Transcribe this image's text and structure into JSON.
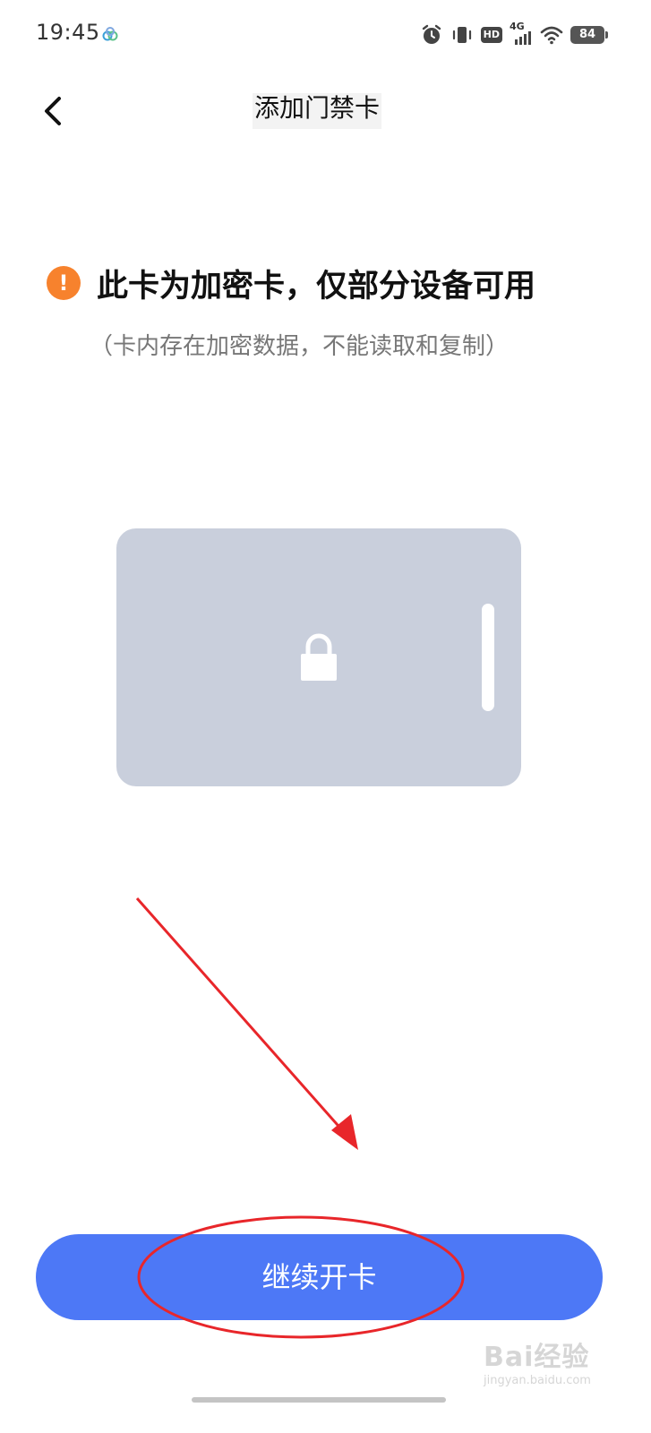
{
  "status_bar": {
    "time": "19:45",
    "network": "4G",
    "hd": "HD",
    "battery": "84"
  },
  "header": {
    "title": "添加门禁卡",
    "back_icon": "chevron-left-icon"
  },
  "warning": {
    "icon": "exclamation-circle-icon",
    "icon_glyph": "!",
    "icon_color": "#f7822d",
    "title": "此卡为加密卡，仅部分设备可用",
    "subtitle": "（卡内存在加密数据，不能读取和复制）"
  },
  "card": {
    "icon": "lock-icon",
    "color": "#c9cfdc"
  },
  "actions": {
    "continue_label": "继续开卡",
    "continue_color": "#4d78f6"
  },
  "annotation": {
    "color": "#e8262a"
  },
  "watermark": {
    "logo": "Bai经验",
    "site": "jingyan.baidu.com"
  }
}
